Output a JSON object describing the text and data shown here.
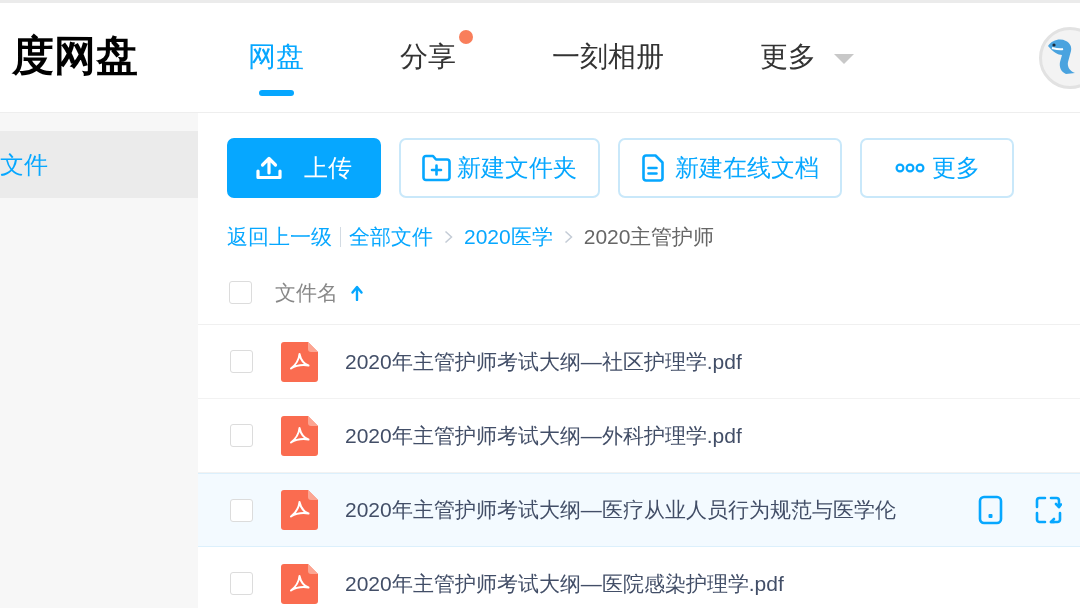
{
  "header": {
    "logo": "度网盘",
    "nav": [
      {
        "label": "网盘",
        "selected": true,
        "badge": false,
        "dropdown": false
      },
      {
        "label": "分享",
        "selected": false,
        "badge": true,
        "dropdown": false
      },
      {
        "label": "一刻相册",
        "selected": false,
        "badge": false,
        "dropdown": false
      },
      {
        "label": "更多",
        "selected": false,
        "badge": false,
        "dropdown": true
      }
    ]
  },
  "sidebar": {
    "items": [
      {
        "label": "文件",
        "selected": true
      }
    ]
  },
  "toolbar": {
    "buttons": [
      {
        "kind": "upload",
        "label": "上传"
      },
      {
        "kind": "new_folder",
        "label": "新建文件夹"
      },
      {
        "kind": "new_doc",
        "label": "新建在线文档"
      },
      {
        "kind": "more",
        "label": "更多"
      }
    ]
  },
  "breadcrumb": {
    "back": "返回上一级",
    "path": [
      {
        "label": "全部文件",
        "current": false
      },
      {
        "label": "2020医学",
        "current": false
      },
      {
        "label": "2020主管护师",
        "current": true
      }
    ]
  },
  "file_list": {
    "select_all": {
      "checked": false
    },
    "columns": [
      {
        "label": "文件名",
        "sort_ascending": true
      }
    ],
    "rows": [
      {
        "kind": "pdf",
        "name": "2020年主管护师考试大纲—社区护理学.pdf",
        "checked": false,
        "hovered": false
      },
      {
        "kind": "pdf",
        "name": "2020年主管护师考试大纲—外科护理学.pdf",
        "checked": false,
        "hovered": false
      },
      {
        "kind": "pdf",
        "name": "2020年主管护师考试大纲—医疗从业人员行为规范与医学伦",
        "checked": false,
        "hovered": true
      },
      {
        "kind": "pdf",
        "name": "2020年主管护师考试大纲—医院感染护理学.pdf",
        "checked": false,
        "hovered": false
      }
    ]
  }
}
